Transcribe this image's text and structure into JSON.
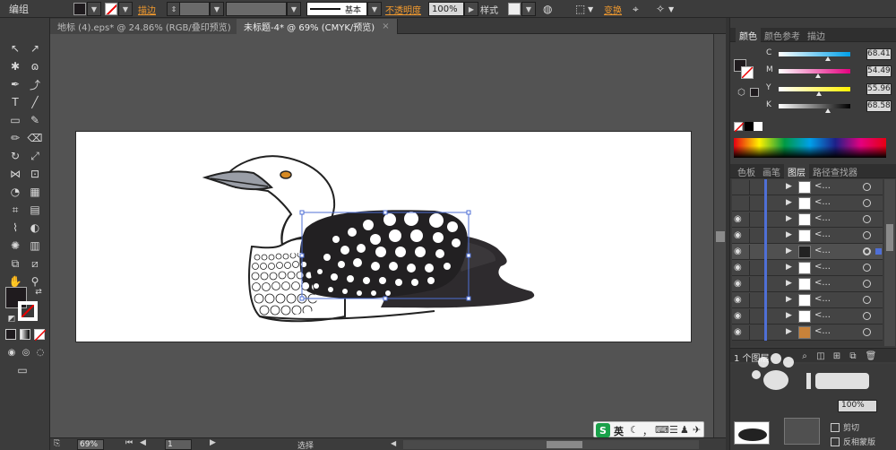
{
  "control_bar": {
    "group_label": "编组",
    "stroke_label": "描边",
    "stroke_profile": "基本",
    "opacity_label": "不透明度",
    "opacity_value": "100%",
    "style_label": "样式",
    "transform_label": "变换"
  },
  "tabs": [
    {
      "label": "地标 (4).eps* @ 24.86% (RGB/叠印预览)",
      "close": "×"
    },
    {
      "label": "未标题-4* @ 69% (CMYK/预览)",
      "close": "×"
    }
  ],
  "status": {
    "zoom": "69%",
    "page": "1",
    "tool": "选择"
  },
  "color_panel": {
    "tabs": [
      "颜色",
      "颜色参考",
      "描边"
    ],
    "channels": [
      {
        "label": "C",
        "value": "68.41",
        "fraction": 0.684,
        "start": "#ffffff",
        "end": "#00a0e9"
      },
      {
        "label": "M",
        "value": "54.49",
        "fraction": 0.545,
        "start": "#ffffff",
        "end": "#e4007f"
      },
      {
        "label": "Y",
        "value": "55.96",
        "fraction": 0.56,
        "start": "#ffffff",
        "end": "#fff100"
      },
      {
        "label": "K",
        "value": "68.58",
        "fraction": 0.686,
        "start": "#ffffff",
        "end": "#000000"
      }
    ]
  },
  "layers_panel": {
    "tabs": [
      "色板",
      "画笔",
      "图层",
      "路径查找器"
    ],
    "count_label": "1 个图层",
    "row_name": "<..."
  },
  "appearance_panel": {
    "opacity_value": "100%",
    "checkbox1": "剪切",
    "checkbox2": "反相蒙版"
  },
  "ime": {
    "mode": "英"
  },
  "colors": {
    "fill": "#1f1b1e",
    "accent_orange": "#f29a2e",
    "layer_stripe": "#4f6fd6"
  }
}
